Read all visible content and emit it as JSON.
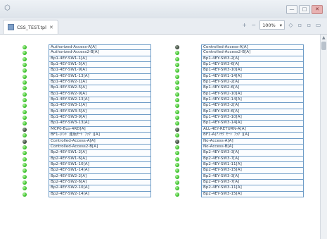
{
  "window": {
    "app_icon": "app-icon",
    "min": "—",
    "max": "□",
    "close": "✕"
  },
  "tab": {
    "title": "CSS_TEST.tpl",
    "close": "✕"
  },
  "toolbar": {
    "zoom_in": "+",
    "zoom_out": "−",
    "zoom_value": "100%",
    "zoom_dropdown": "▾"
  },
  "colors": {
    "led_on": "#39c12a",
    "led_off": "#3d4a3d",
    "cell_border": "#6e9cc7"
  },
  "left_rows": [
    {
      "label": "Authorized-Access-A[A]",
      "state": "on"
    },
    {
      "label": "Authorized-Access2-B[A]",
      "state": "on"
    },
    {
      "label": "Bp1-4EY-SW1-1[A]",
      "state": "on"
    },
    {
      "label": "Bp1-4EY-SW1-5[A]",
      "state": "on"
    },
    {
      "label": "Bp1-4EY-SW1-9[A]",
      "state": "on"
    },
    {
      "label": "Bp1-4EY-SW1-13[A]",
      "state": "on"
    },
    {
      "label": "Bp1-4EY-SW2-1[A]",
      "state": "on"
    },
    {
      "label": "Bp1-4EY-SW2-5[A]",
      "state": "on"
    },
    {
      "label": "Bp1-4EY-SW2-9[A]",
      "state": "on"
    },
    {
      "label": "Bp1-4EY-SW2-13[A]",
      "state": "on"
    },
    {
      "label": "Bp1-4EY-SW3-1[A]",
      "state": "on"
    },
    {
      "label": "Bp1-4EY-SW3-5[A]",
      "state": "on"
    },
    {
      "label": "Bp1-4EY-SW3-9[A]",
      "state": "on"
    },
    {
      "label": "Bp1-4EY-SW3-13[A]",
      "state": "on"
    },
    {
      "label": "MCP0-Bus-4RD[A]",
      "state": "off"
    },
    {
      "label": "BF1-(ﾊﾝﾄﾞ運転ﾓｰﾄﾞﾌﾗｸﾞ)[A]",
      "state": "on"
    },
    {
      "label": "Controlled-Access-A[A]",
      "state": "off"
    },
    {
      "label": "Controlled-Access2-B[A]",
      "state": "on"
    },
    {
      "label": "Bp2-4EY-SW1-2[A]",
      "state": "on"
    },
    {
      "label": "Bp2-4EY-SW1-6[A]",
      "state": "on"
    },
    {
      "label": "Bp2-4EY-SW1-10[A]",
      "state": "on"
    },
    {
      "label": "Bp2-4EY-SW1-14[A]",
      "state": "on"
    },
    {
      "label": "Bp2-4EY-SW2-2[A]",
      "state": "on"
    },
    {
      "label": "Bp2-4EY-SW2-6[A]",
      "state": "on"
    },
    {
      "label": "Bp2-4EY-SW2-10[A]",
      "state": "on"
    },
    {
      "label": "Bp2-4EY-SW2-14[A]",
      "state": "on"
    }
  ],
  "right_rows": [
    {
      "label": "Controlled-Access-A[A]",
      "state": "off"
    },
    {
      "label": "Controlled-Access2-B[A]",
      "state": "on"
    },
    {
      "label": "Bp1-4EY-SW3-2[A]",
      "state": "on"
    },
    {
      "label": "Bp1-4EY-SW3-6[A]",
      "state": "on"
    },
    {
      "label": "Bp1-4EY-SW3-10[A]",
      "state": "on"
    },
    {
      "label": "Bp1-4EY-SW1-14[A]",
      "state": "on"
    },
    {
      "label": "Bp1-4EY-SW2-2[A]",
      "state": "on"
    },
    {
      "label": "Bp1-4EY-SW2-6[A]",
      "state": "on"
    },
    {
      "label": "Bp1-4EY-SW2-10[A]",
      "state": "on"
    },
    {
      "label": "Bp1-4EY-SW2-14[A]",
      "state": "on"
    },
    {
      "label": "Bp1-4EY-SW3-2[A]",
      "state": "on"
    },
    {
      "label": "Bp1-4EY-SW3-6[A]",
      "state": "on"
    },
    {
      "label": "Bp1-4EY-SW3-10[A]",
      "state": "on"
    },
    {
      "label": "Bp1-4EY-SW3-14[A]",
      "state": "on"
    },
    {
      "label": "ALL-4EY-RETURN-A[A]",
      "state": "off"
    },
    {
      "label": "BF1-A(ｱﾝﾁｸﾞﾓｰﾄﾞﾌﾗｸﾞ)[A]",
      "state": "on"
    },
    {
      "label": "No-Access-A[A]",
      "state": "off"
    },
    {
      "label": "No-Access-B[A]",
      "state": "on"
    },
    {
      "label": "Bp2-4EY-SW3-3[A]",
      "state": "on"
    },
    {
      "label": "Bp2-4EY-SW3-7[A]",
      "state": "on"
    },
    {
      "label": "Bp2-4EY-SW1-11[A]",
      "state": "on"
    },
    {
      "label": "Bp2-4EY-SW3-15[A]",
      "state": "on"
    },
    {
      "label": "Bp2-4EY-SW3-3[A]",
      "state": "on"
    },
    {
      "label": "Bp2-4EY-SW3-7[A]",
      "state": "on"
    },
    {
      "label": "Bp2-4EY-SW3-11[A]",
      "state": "on"
    },
    {
      "label": "Bp2-4EY-SW3-15[A]",
      "state": "on"
    }
  ]
}
